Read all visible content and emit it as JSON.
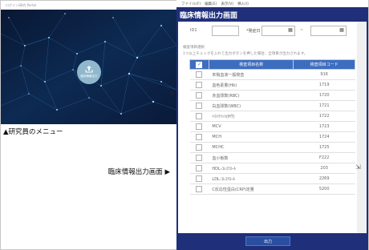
{
  "left": {
    "small_title": "ログイン/研究 Portal",
    "center_button_label": "臨床情報出力",
    "caption_menu": "▲研究員のメニュー",
    "caption_screen": "臨床情報出力画面 ▶"
  },
  "window": {
    "menu": [
      "ファイル(F)",
      "編集(E)",
      "表示(V)",
      "挿入(I)"
    ],
    "title": "臨床情報出力画面",
    "search": {
      "id_label": "ID1",
      "date_label": "*発症日",
      "tilde": "~",
      "id_value": "",
      "date_from": "",
      "date_to": ""
    },
    "section_label": "検査項目選択",
    "section_note": "1つ以上チェックを入れて出力ボタンを押した場合、全項目が出力されます。",
    "table": {
      "header_check": "✓",
      "col_name": "検査項目名称",
      "col_code": "検査項目コード",
      "rows": [
        {
          "name": "末梢血液一般検査",
          "code": "916"
        },
        {
          "name": "血色素量(Hb)",
          "code": "1719"
        },
        {
          "name": "赤血球数(RBC)",
          "code": "1720"
        },
        {
          "name": "白血球数(WBC)",
          "code": "1721"
        },
        {
          "name": "ﾍﾏﾄｸﾘｯﾄ(HT)",
          "code": "1722"
        },
        {
          "name": "MCV",
          "code": "1723"
        },
        {
          "name": "MCH",
          "code": "1724"
        },
        {
          "name": "MCHC",
          "code": "1725"
        },
        {
          "name": "血小板数",
          "code": "F222"
        },
        {
          "name": "HDL-ｺﾚｽﾃﾛｰﾙ",
          "code": "203"
        },
        {
          "name": "LDL-ｺﾚｽﾃﾛｰﾙ",
          "code": "2269"
        },
        {
          "name": "C反応性蛋白(CRP)定量",
          "code": "5200"
        }
      ]
    },
    "output_button": "出力"
  },
  "colors": {
    "navy": "#1f2f7a",
    "table_header": "#3d6dbf",
    "hero_bg": "#0e1a3c"
  }
}
